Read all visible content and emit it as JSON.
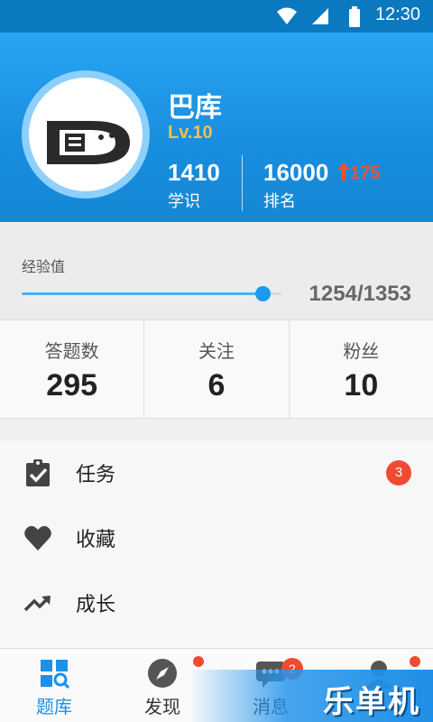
{
  "status_bar": {
    "time": "12:30",
    "icons": [
      "wifi-icon",
      "signal-icon",
      "battery-icon"
    ]
  },
  "profile": {
    "username": "巴库",
    "level": "Lv.10",
    "knowledge_value": "1410",
    "knowledge_label": "学识",
    "rank_value": "16000",
    "rank_change": "175",
    "rank_label": "排名"
  },
  "experience": {
    "title": "经验值",
    "value_text": "1254/1353",
    "progress": 0.927
  },
  "counts": [
    {
      "label": "答题数",
      "value": "295"
    },
    {
      "label": "关注",
      "value": "6"
    },
    {
      "label": "粉丝",
      "value": "10"
    }
  ],
  "menu": [
    {
      "label": "任务",
      "icon": "clipboard-check-icon",
      "badge": "3"
    },
    {
      "label": "收藏",
      "icon": "heart-icon"
    },
    {
      "label": "成长",
      "icon": "trending-up-icon"
    }
  ],
  "tabs": [
    {
      "label": "题库",
      "icon": "grid-search-icon",
      "active": true
    },
    {
      "label": "发现",
      "icon": "compass-icon"
    },
    {
      "label": "消息",
      "icon": "chat-icon",
      "badge": "2"
    },
    {
      "label": "",
      "icon": "profile-icon"
    }
  ],
  "watermark": "乐单机",
  "colors": {
    "accent": "#1e90e6",
    "badge": "#f04a32",
    "level": "#f3c04a"
  }
}
